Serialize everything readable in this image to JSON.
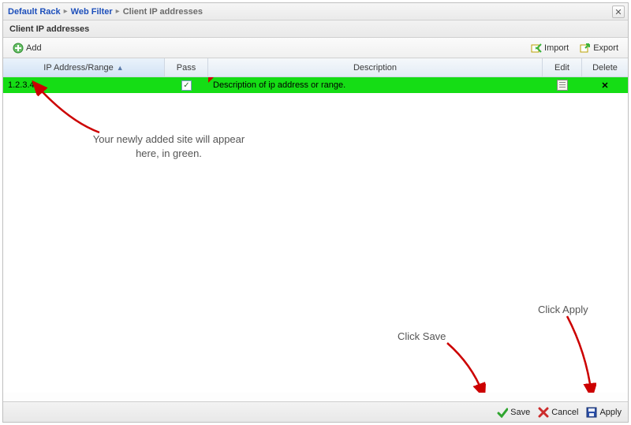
{
  "breadcrumb": {
    "root": "Default Rack",
    "mid": "Web Filter",
    "current": "Client IP addresses"
  },
  "title": "Client IP addresses",
  "toolbar": {
    "add": "Add",
    "import": "Import",
    "export": "Export"
  },
  "columns": {
    "ip": "IP Address/Range",
    "pass": "Pass",
    "description": "Description",
    "edit": "Edit",
    "delete": "Delete"
  },
  "rows": [
    {
      "ip": "1.2.3.4",
      "pass": true,
      "description": "Description of ip address or range.",
      "is_new": true
    }
  ],
  "annotations": {
    "new_row": "Your newly added site will appear\nhere, in green.",
    "click_save": "Click Save",
    "click_apply": "Click Apply"
  },
  "footer": {
    "save": "Save",
    "cancel": "Cancel",
    "apply": "Apply"
  },
  "glyphs": {
    "close": "✕",
    "check": "✓",
    "del": "✕",
    "sep": "▸",
    "sort_asc": "▲"
  }
}
